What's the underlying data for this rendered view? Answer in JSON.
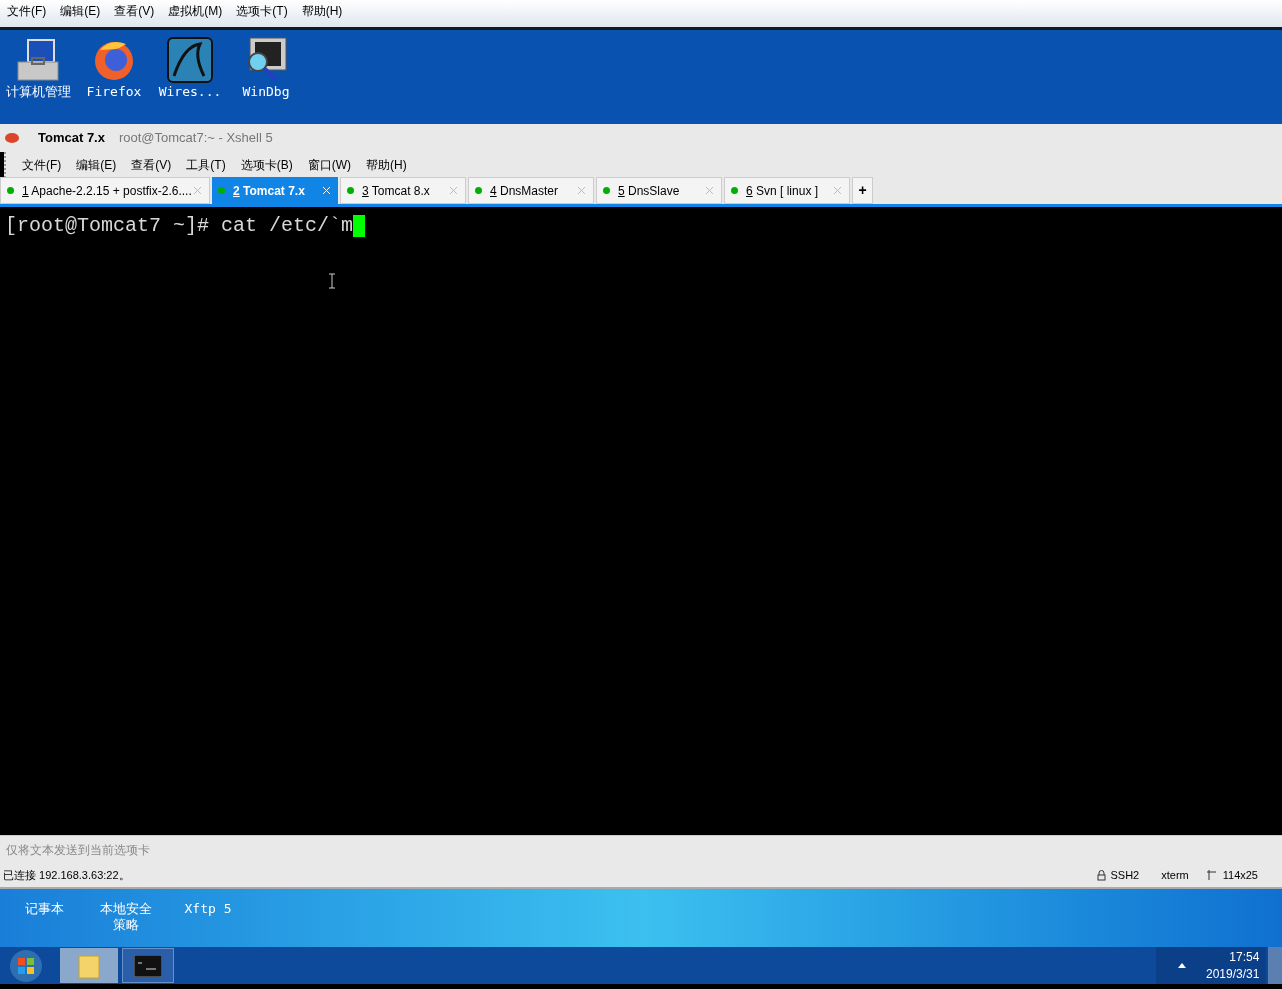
{
  "vm_menu": [
    "文件(F)",
    "编辑(E)",
    "查看(V)",
    "虚拟机(M)",
    "选项卡(T)",
    "帮助(H)"
  ],
  "desktop_icons": [
    {
      "kind": "computer",
      "label": "计算机管理"
    },
    {
      "kind": "browser",
      "label": "Firefox"
    },
    {
      "kind": "fin",
      "label": "Wires..."
    },
    {
      "kind": "debugger",
      "label": "WinDbg"
    }
  ],
  "window": {
    "title": "Tomcat 7.x",
    "subtitle": "root@Tomcat7:~ - Xshell 5"
  },
  "menu": [
    "文件(F)",
    "编辑(E)",
    "查看(V)",
    "工具(T)",
    "选项卡(B)",
    "窗口(W)",
    "帮助(H)"
  ],
  "tabs": [
    {
      "number": "1",
      "label": " Apache-2.2.15 + postfix-2.6....",
      "selected": false,
      "color": "#00b000"
    },
    {
      "number": "2",
      "label": " Tomcat 7.x",
      "selected": true,
      "color": "#00b000"
    },
    {
      "number": "3",
      "label": " Tomcat 8.x",
      "selected": false,
      "color": "#00b000"
    },
    {
      "number": "4",
      "label": " DnsMaster",
      "selected": false,
      "color": "#00b000"
    },
    {
      "number": "5",
      "label": " DnsSlave",
      "selected": false,
      "color": "#00b000"
    },
    {
      "number": "6",
      "label": " Svn [ linux ]",
      "selected": false,
      "color": "#00b000"
    }
  ],
  "new_tab": "+",
  "terminal": {
    "prompt": "[root@Tomcat7 ~]# cat /etc/`m"
  },
  "compose_bar": {
    "placeholder": "仅将文本发送到当前选项卡"
  },
  "status_bar": {
    "connection": "已连接 192.168.3.63:22。",
    "protocol": "SSH2",
    "terminal_type": "xterm",
    "size": "114x25"
  },
  "desktop_bottom_icons": [
    "记事本",
    "本地安全策略",
    "Xftp 5"
  ],
  "taskbar": {
    "time": "17:54",
    "date": "2019/3/31"
  }
}
